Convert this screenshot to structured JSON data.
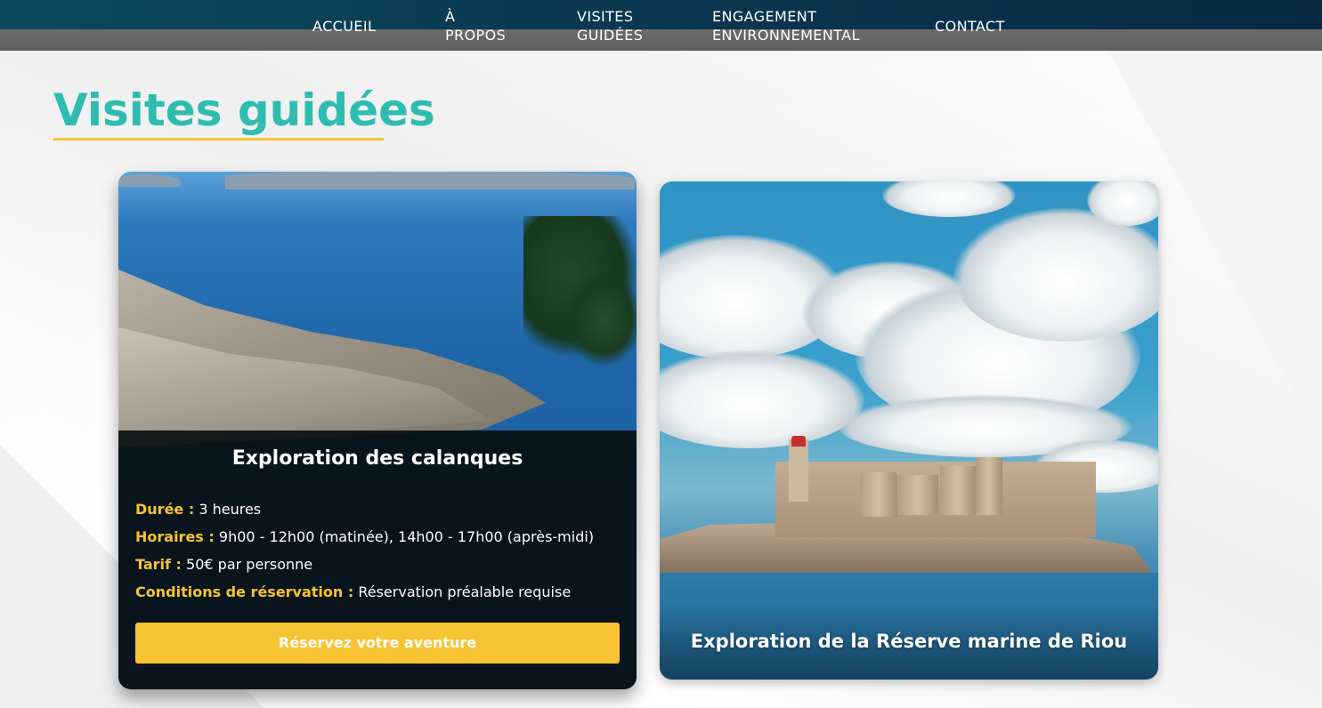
{
  "nav": {
    "accueil": "ACCUEIL",
    "apropos_line1": "À",
    "apropos_line2": "PROPOS",
    "visites_line1": "VISITES",
    "visites_line2": "GUIDÉES",
    "engagement_line1": "ENGAGEMENT",
    "engagement_line2": "ENVIRONNEMENTAL",
    "contact": "CONTACT"
  },
  "page": {
    "title": "Visites guidées"
  },
  "cards": [
    {
      "title": "Exploration des calanques",
      "duree_label": "Durée :",
      "duree_value": " 3 heures",
      "horaires_label": "Horaires :",
      "horaires_value": " 9h00 - 12h00 (matinée), 14h00 - 17h00 (après-midi)",
      "tarif_label": "Tarif :",
      "tarif_value": " 50€ par personne",
      "conditions_label": "Conditions de réservation :",
      "conditions_value": " Réservation préalable requise",
      "button_label": "Réservez votre aventure"
    },
    {
      "title": "Exploration de la Réserve marine de Riou"
    }
  ],
  "colors": {
    "accent_teal": "#2fbcb0",
    "accent_yellow": "#f6c433",
    "nav_dark": "#0a3347"
  }
}
